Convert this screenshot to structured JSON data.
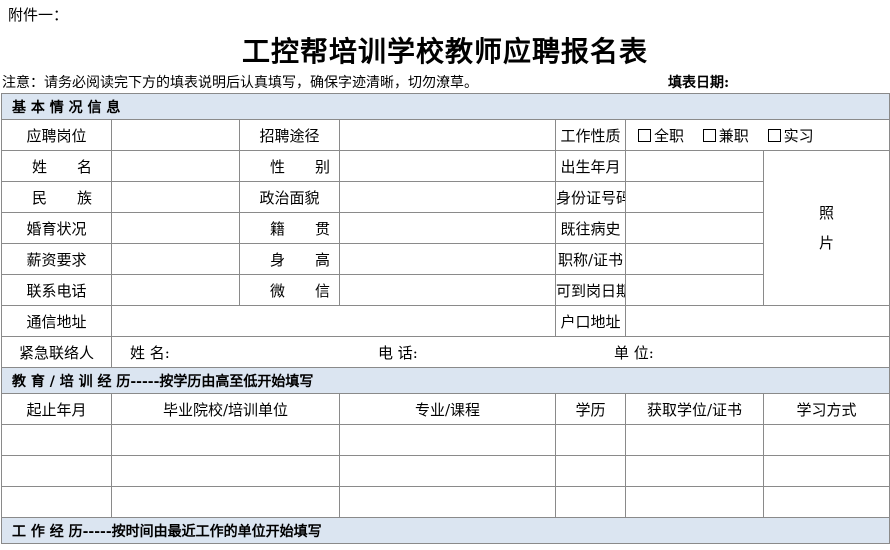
{
  "attachment_label": "附件一：",
  "form_title": "工控帮培训学校教师应聘报名表",
  "notice": "注意：请务必阅读完下方的填表说明后认真填写，确保字迹清晰，切勿潦草。",
  "date_label": "填表日期:",
  "basic": {
    "section_title": "基 本 情 况 信 息",
    "position": "应聘岗位",
    "channel": "招聘途径",
    "work_nature": "工作性质",
    "options": [
      "全职",
      "兼职",
      "实习"
    ],
    "name": "姓名",
    "gender": "性别",
    "birth": "出生年月",
    "ethnicity": "民族",
    "political": "政治面貌",
    "id_number": "身份证号码",
    "marital": "婚育状况",
    "origin": "籍贯",
    "medical": "既往病史",
    "salary": "薪资要求",
    "height": "身高",
    "title_cert": "职称/证书",
    "phone": "联系电话",
    "wechat": "微信",
    "start_date": "可到岗日期",
    "address": "通信地址",
    "hukou": "户口地址",
    "photo_1": "照",
    "photo_2": "片",
    "emergency": "紧急联络人",
    "em_name": "姓  名:",
    "em_phone": "电  话:",
    "em_unit": "单  位:"
  },
  "education": {
    "section_title": "教 育 / 培 训 经 历-----按学历由高至低开始填写",
    "headers": [
      "起止年月",
      "毕业院校/培训单位",
      "专业/课程",
      "学历",
      "获取学位/证书",
      "学习方式"
    ],
    "blank_rows": 3
  },
  "work": {
    "section_title": "工 作 经 历-----按时间由最近工作的单位开始填写"
  }
}
